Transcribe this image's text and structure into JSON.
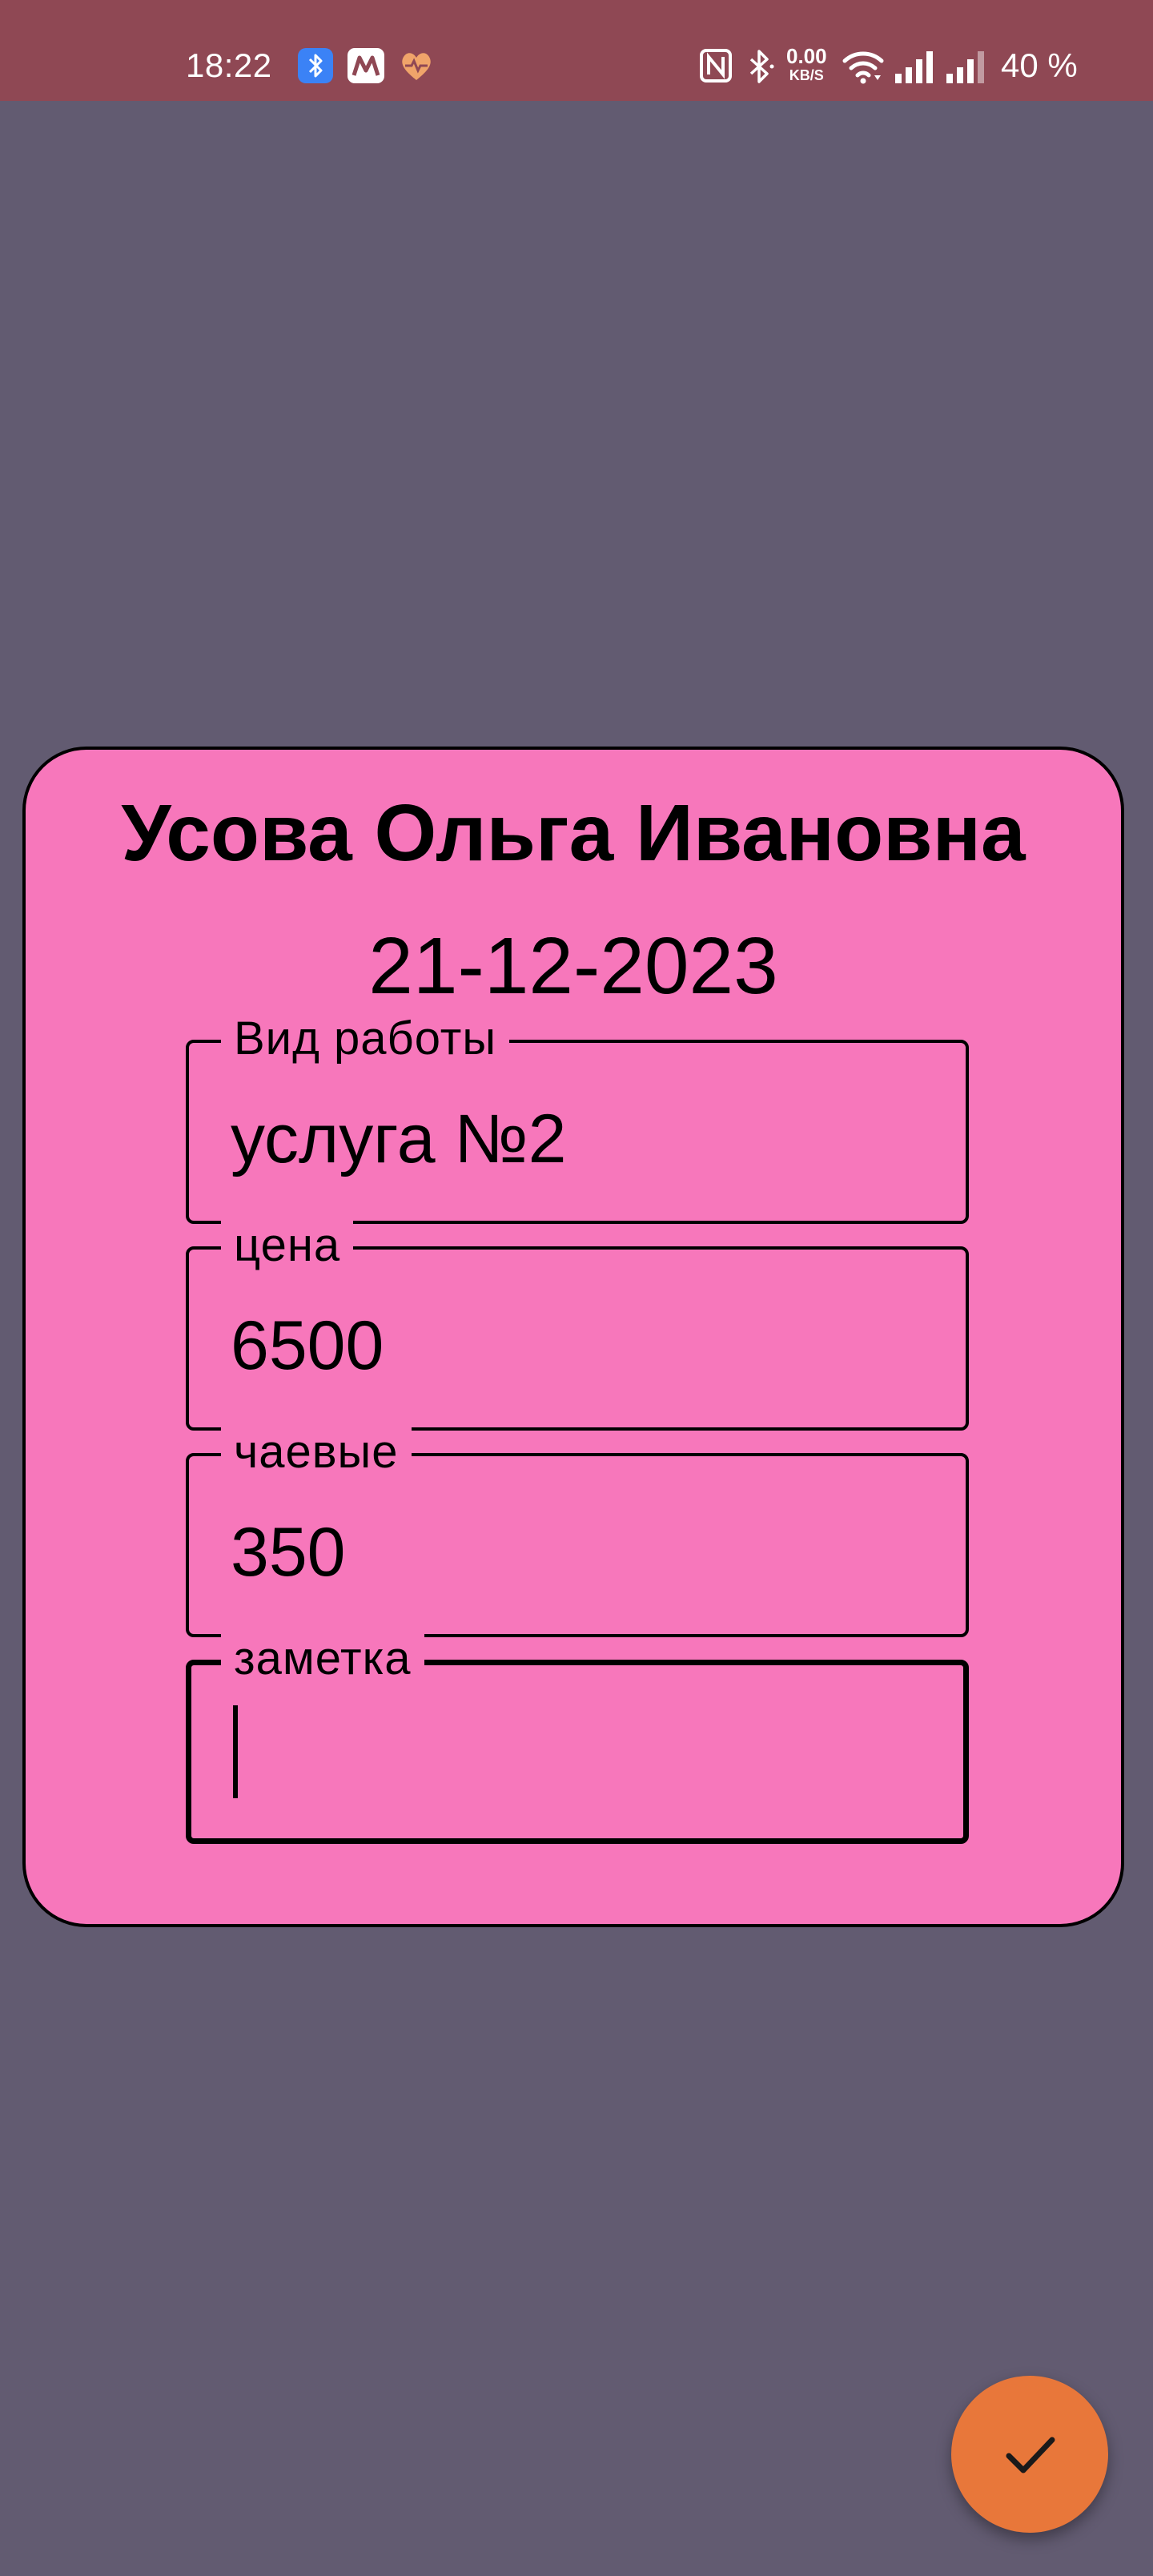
{
  "status_bar": {
    "time": "18:22",
    "notification_icons": [
      "bluetooth-app-icon",
      "mail-app-icon",
      "health-app-icon"
    ],
    "system_icons": [
      "nfc-icon",
      "bluetooth-icon",
      "wifi-icon",
      "signal-icon",
      "signal-icon-2"
    ],
    "net_speed_value": "0.00",
    "net_speed_unit": "KB/S",
    "battery": "40 %",
    "background_color": "#8f4854"
  },
  "card": {
    "client_name": "Усова Ольга Ивановна",
    "date": "21-12-2023",
    "background_color": "#f777bb",
    "fields": {
      "work_type": {
        "label": "Вид работы",
        "value": "услуга №2"
      },
      "price": {
        "label": "цена",
        "value": "6500"
      },
      "tips": {
        "label": "чаевые",
        "value": "350"
      },
      "note": {
        "label": "заметка",
        "value": ""
      }
    }
  },
  "fab": {
    "icon": "check-icon",
    "color": "#e8773a"
  },
  "page": {
    "background_color": "#625b71"
  }
}
